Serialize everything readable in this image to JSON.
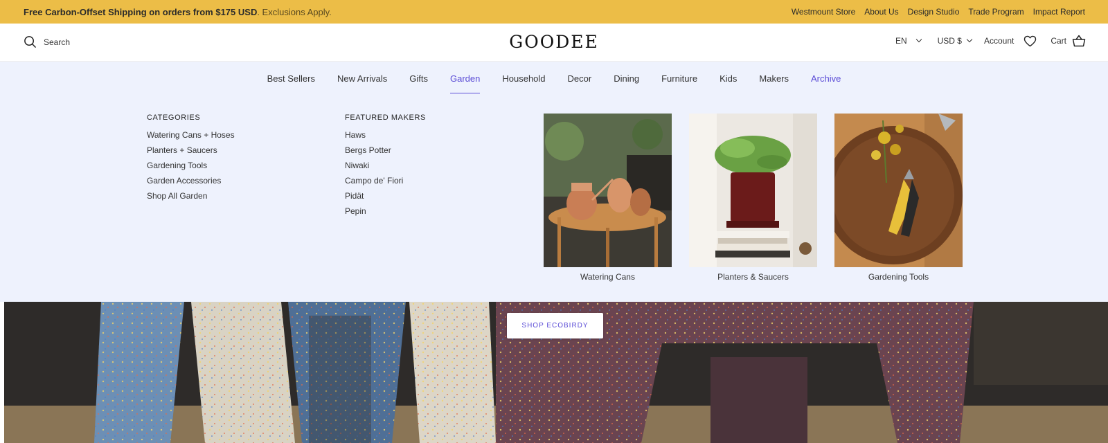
{
  "announcement": {
    "promo_bold": "Free Carbon-Offset Shipping on orders from $175 USD",
    "promo_rest": ". Exclusions Apply.",
    "links": [
      "Westmount Store",
      "About Us",
      "Design Studio",
      "Trade Program",
      "Impact Report"
    ]
  },
  "header": {
    "search_label": "Search",
    "logo": "GOODEE",
    "language": "EN",
    "currency": "USD $",
    "account": "Account",
    "cart": "Cart"
  },
  "nav": {
    "items": [
      "Best Sellers",
      "New Arrivals",
      "Gifts",
      "Garden",
      "Household",
      "Decor",
      "Dining",
      "Furniture",
      "Kids",
      "Makers",
      "Archive"
    ],
    "active": "Garden"
  },
  "mega_menu": {
    "categories": {
      "heading": "CATEGORIES",
      "items": [
        "Watering Cans + Hoses",
        "Planters + Saucers",
        "Gardening Tools",
        "Garden Accessories",
        "Shop All Garden"
      ]
    },
    "makers": {
      "heading": "FEATURED MAKERS",
      "items": [
        "Haws",
        "Bergs Potter",
        "Niwaki",
        "Campo de' Fiori",
        "Pidät",
        "Pepin"
      ]
    },
    "tiles": [
      {
        "caption": "Watering Cans"
      },
      {
        "caption": "Planters & Saucers"
      },
      {
        "caption": "Gardening Tools"
      }
    ]
  },
  "hero": {
    "button_label": "SHOP ECOBIRDY"
  },
  "colors": {
    "announcement_bg": "#ecbd47",
    "menu_bg": "#eef2fd",
    "accent": "#5a4bd6"
  }
}
